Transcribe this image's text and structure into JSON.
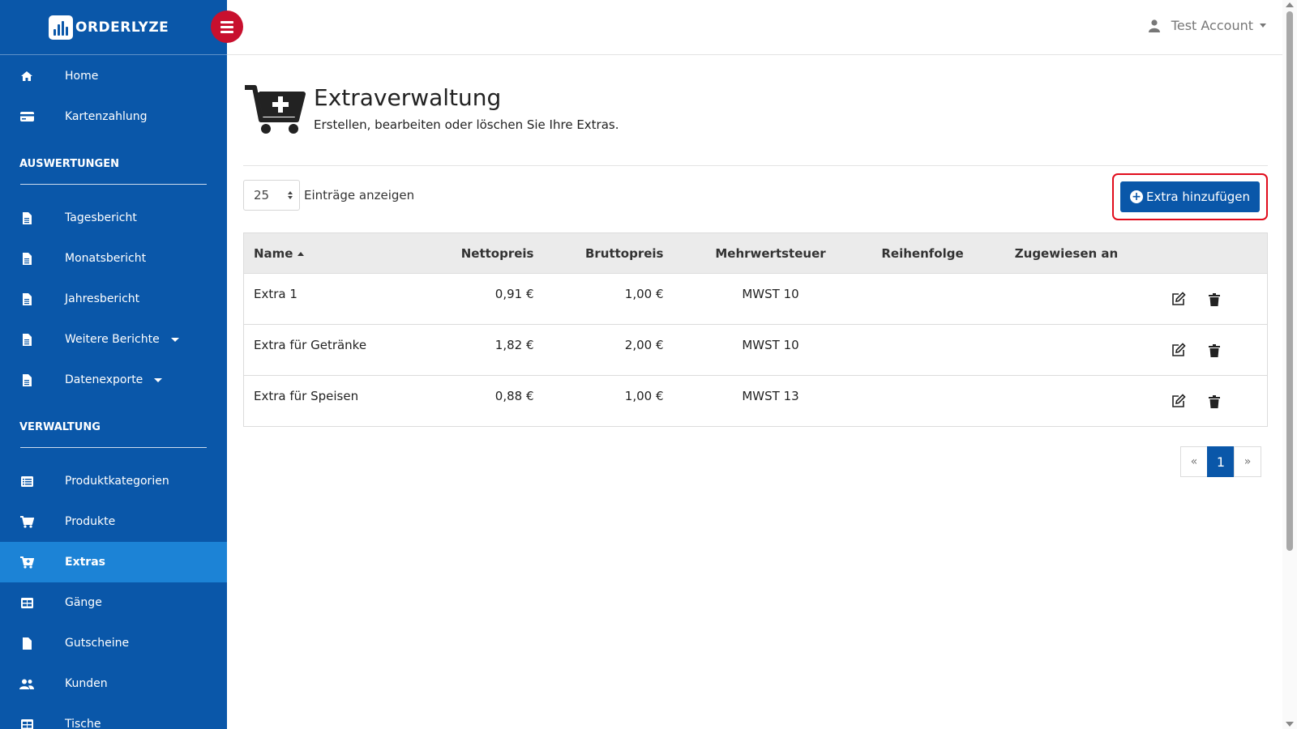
{
  "brand": {
    "name": "ORDERLYZE"
  },
  "account": {
    "label": "Test Account"
  },
  "sidebar": {
    "top_items": [
      {
        "label": "Home",
        "icon": "home-icon"
      },
      {
        "label": "Kartenzahlung",
        "icon": "credit-card-icon"
      }
    ],
    "sections": [
      {
        "heading": "AUSWERTUNGEN",
        "items": [
          {
            "label": "Tagesbericht",
            "icon": "file-icon"
          },
          {
            "label": "Monatsbericht",
            "icon": "file-icon"
          },
          {
            "label": "Jahresbericht",
            "icon": "file-icon"
          },
          {
            "label": "Weitere Berichte",
            "icon": "file-icon",
            "has_caret": true
          },
          {
            "label": "Datenexporte",
            "icon": "file-icon",
            "has_caret": true
          }
        ]
      },
      {
        "heading": "VERWALTUNG",
        "items": [
          {
            "label": "Produktkategorien",
            "icon": "list-icon"
          },
          {
            "label": "Produkte",
            "icon": "cart-icon"
          },
          {
            "label": "Extras",
            "icon": "cart-plus-icon",
            "active": true
          },
          {
            "label": "Gänge",
            "icon": "table-icon"
          },
          {
            "label": "Gutscheine",
            "icon": "document-icon"
          },
          {
            "label": "Kunden",
            "icon": "users-icon"
          },
          {
            "label": "Tische",
            "icon": "table-icon"
          }
        ]
      }
    ]
  },
  "page": {
    "title": "Extraverwaltung",
    "subtitle": "Erstellen, bearbeiten oder löschen Sie Ihre Extras.",
    "page_size": "25",
    "entries_label": "Einträge anzeigen",
    "add_button": "Extra hinzufügen"
  },
  "table": {
    "headers": [
      "Name",
      "Nettopreis",
      "Bruttopreis",
      "Mehrwertsteuer",
      "Reihenfolge",
      "Zugewiesen an"
    ],
    "rows": [
      {
        "name": "Extra 1",
        "netto": "0,91 €",
        "brutto": "1,00 €",
        "mwst": "MWST 10",
        "reihenfolge": "",
        "zugewiesen": ""
      },
      {
        "name": "Extra für Getränke",
        "netto": "1,82 €",
        "brutto": "2,00 €",
        "mwst": "MWST 10",
        "reihenfolge": "",
        "zugewiesen": ""
      },
      {
        "name": "Extra für Speisen",
        "netto": "0,88 €",
        "brutto": "1,00 €",
        "mwst": "MWST 13",
        "reihenfolge": "",
        "zugewiesen": ""
      }
    ]
  },
  "pagination": {
    "prev": "«",
    "current": "1",
    "next": "»"
  },
  "colors": {
    "sidebar": "#0a57a9",
    "active_item": "#1c83d6",
    "toggle": "#c8102e",
    "highlight": "#e10c1c"
  }
}
